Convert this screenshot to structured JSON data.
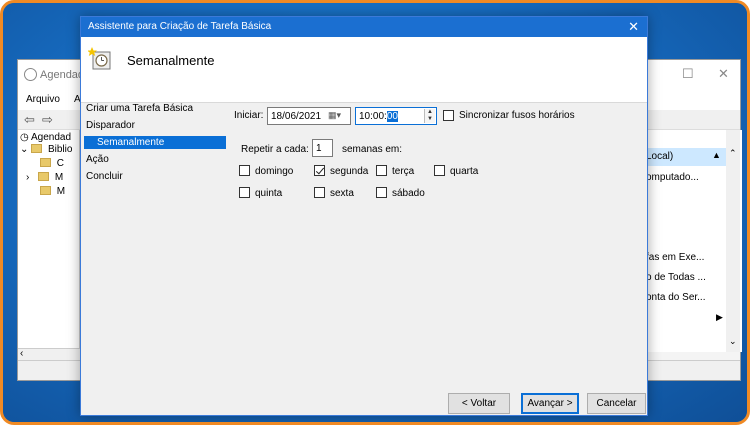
{
  "background_window": {
    "title": "Agendad",
    "menu": [
      "Arquivo",
      "A"
    ],
    "tree": {
      "root": "Agendad",
      "library": "Biblio",
      "children": [
        "C",
        "M",
        "M"
      ]
    },
    "right_header": "Local)",
    "right_items": [
      "omputado...",
      "fas em Exe...",
      "o de Todas ...",
      "onta do Ser..."
    ]
  },
  "dialog": {
    "title": "Assistente para Criação de Tarefa Básica",
    "header_title": "Semanalmente",
    "nav": {
      "items": [
        "Criar uma Tarefa Básica",
        "Disparador",
        "Semanalmente",
        "Ação",
        "Concluir"
      ],
      "selected": "Semanalmente"
    },
    "start": {
      "label": "Iniciar:",
      "date": "18/06/2021",
      "time_prefix": "10:00:",
      "time_selected": "00",
      "sync_label": "Sincronizar fusos horários",
      "sync_checked": false
    },
    "repeat": {
      "label": "Repetir a cada:",
      "value": "1",
      "suffix": "semanas em:"
    },
    "days": [
      {
        "label": "domingo",
        "checked": false
      },
      {
        "label": "segunda",
        "checked": true
      },
      {
        "label": "terça",
        "checked": false
      },
      {
        "label": "quarta",
        "checked": false
      },
      {
        "label": "quinta",
        "checked": false
      },
      {
        "label": "sexta",
        "checked": false
      },
      {
        "label": "sábado",
        "checked": false
      }
    ],
    "buttons": {
      "back": "< Voltar",
      "next": "Avançar >",
      "cancel": "Cancelar"
    }
  },
  "colors": {
    "accent": "#0a6fd6",
    "titlebar": "#1b6fd1",
    "frame_border": "#f08a24",
    "desktop": "#1a6fc4"
  }
}
